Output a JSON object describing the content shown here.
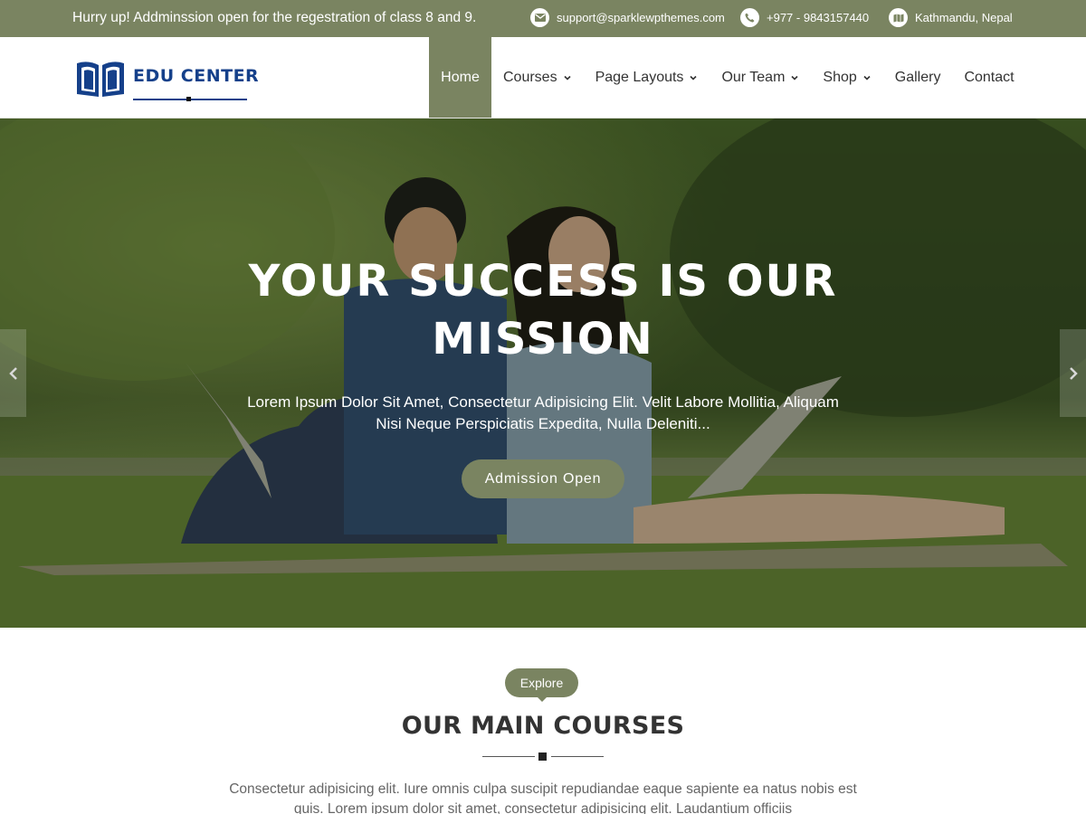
{
  "topbar": {
    "notice": "Hurry up! Addminssion open for the regestration of class 8 and 9.",
    "email": "support@sparklewpthemes.com",
    "phone": "+977 - 9843157440",
    "location": "Kathmandu, Nepal",
    "icons": {
      "email": "envelope-icon",
      "phone": "phone-icon",
      "location": "map-icon"
    }
  },
  "header": {
    "logo_text": "EDU CENTER",
    "logo_icon": "open-book-icon",
    "nav": [
      {
        "label": "Home",
        "active": true,
        "dropdown": false
      },
      {
        "label": "Courses",
        "active": false,
        "dropdown": true
      },
      {
        "label": "Page Layouts",
        "active": false,
        "dropdown": true
      },
      {
        "label": "Our Team",
        "active": false,
        "dropdown": true
      },
      {
        "label": "Shop",
        "active": false,
        "dropdown": true
      },
      {
        "label": "Gallery",
        "active": false,
        "dropdown": false
      },
      {
        "label": "Contact",
        "active": false,
        "dropdown": false
      }
    ]
  },
  "hero": {
    "title": "YOUR SUCCESS IS OUR MISSION",
    "text": "Lorem Ipsum Dolor Sit Amet, Consectetur Adipisicing Elit. Velit Labore Mollitia, Aliquam Nisi Neque Perspiciatis Expedita, Nulla Deleniti...",
    "button_label": "Admission Open",
    "prev_icon": "chevron-left-icon",
    "next_icon": "chevron-right-icon"
  },
  "courses": {
    "badge": "Explore",
    "title": "OUR MAIN COURSES",
    "description": "Consectetur adipisicing elit. Iure omnis culpa suscipit repudiandae eaque sapiente ea natus nobis est quis. Lorem ipsum dolor sit amet, consectetur adipisicing elit. Laudantium officiis"
  },
  "colors": {
    "accent": "#7a8461",
    "logo_blue": "#15408a"
  }
}
